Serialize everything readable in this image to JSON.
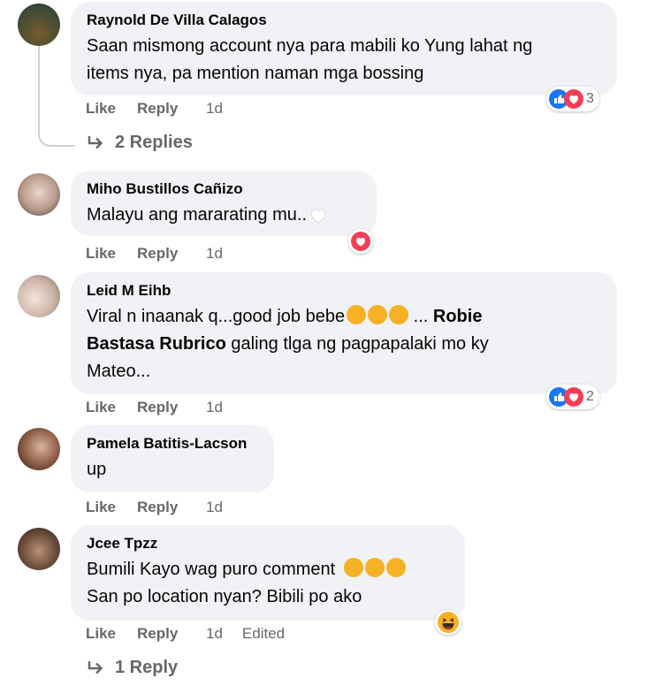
{
  "comments": [
    {
      "author": "Raynold De Villa Calagos",
      "text_lines": [
        "Saan mismong account nya para mabili ko Yung lahat ng",
        "items nya, pa mention naman mga bossing"
      ],
      "actions": {
        "like": "Like",
        "reply": "Reply",
        "time": "1d"
      },
      "reaction_count": "3",
      "replies_label": "2 Replies"
    },
    {
      "author": "Miho Bustillos Cañizo",
      "text": "Malayu ang mararating mu..",
      "actions": {
        "like": "Like",
        "reply": "Reply",
        "time": "1d"
      }
    },
    {
      "author": "Leid M Eihb",
      "text_a": "Viral n inaanak q...good job bebe",
      "text_b": " ... ",
      "mention_1": "Robie",
      "mention_2": "Bastasa Rubrico",
      "text_c": " galing tlga ng pagpapalaki mo ky",
      "text_d": "Mateo...",
      "actions": {
        "like": "Like",
        "reply": "Reply",
        "time": "1d"
      },
      "reaction_count": "2"
    },
    {
      "author": "Pamela Batitis-Lacson",
      "text": "up",
      "actions": {
        "like": "Like",
        "reply": "Reply",
        "time": "1d"
      }
    },
    {
      "author": "Jcee Tpzz",
      "text_line1": "Bumili Kayo wag puro comment",
      "text_line2": "San po location nyan? Bibili po ako",
      "actions": {
        "like": "Like",
        "reply": "Reply",
        "time": "1d",
        "edited": "Edited"
      },
      "replies_label": "1 Reply"
    }
  ],
  "colors": {
    "like_blue": "#1877f2",
    "love_red": "#f33e58",
    "emoji_yellow": "#f7b125",
    "meta_gray": "#65676b",
    "bubble": "#f0f2f5"
  }
}
